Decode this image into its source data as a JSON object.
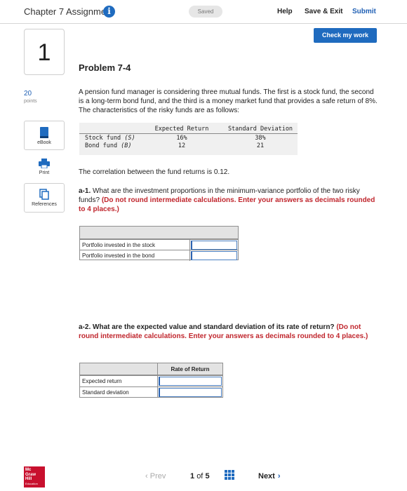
{
  "header": {
    "title": "Chapter 7 Assignment",
    "info_glyph": "i",
    "saved": "Saved",
    "help": "Help",
    "save_exit": "Save & Exit",
    "submit": "Submit",
    "check_work": "Check my work"
  },
  "question": {
    "number": "1",
    "points": "20",
    "points_label": "points"
  },
  "tools": {
    "ebook": "eBook",
    "print": "Print",
    "references": "References"
  },
  "problem": {
    "title": "Problem 7-4",
    "intro": "A pension fund manager is considering three mutual funds. The first is a stock fund, the second is a long-term bond fund, and the third is a money market fund that provides a safe return of 8%. The characteristics of the risky funds are as follows:",
    "table": {
      "headers": [
        "Expected Return",
        "Standard Deviation"
      ],
      "rows": [
        {
          "name": "Stock fund",
          "symbol": "(S)",
          "expected_return": "16%",
          "std_dev": "38%"
        },
        {
          "name": "Bond fund",
          "symbol": "(B)",
          "expected_return": "12",
          "std_dev": "21"
        }
      ]
    },
    "correlation": "The correlation between the fund returns is 0.12.",
    "a1": {
      "label": "a-1.",
      "text": "What are the investment proportions in the minimum-variance portfolio of the two risky funds?",
      "instruction": "(Do not round intermediate calculations. Enter your answers as decimals rounded to 4 places.)",
      "rows": [
        "Portfolio invested in the stock",
        "Portfolio invested in the bond"
      ]
    },
    "a2": {
      "label": "a-2.",
      "text": "What are the expected value and standard deviation of its rate of return?",
      "instruction": "(Do not round intermediate calculations. Enter your answers as decimals rounded to 4 places.)",
      "column": "Rate of Return",
      "rows": [
        "Expected return",
        "Standard deviation"
      ]
    }
  },
  "footer": {
    "logo_lines": [
      "Mc",
      "Graw",
      "Hill",
      "Education"
    ],
    "prev": "Prev",
    "page_current": "1",
    "page_of": "of",
    "page_total": "5",
    "next": "Next"
  },
  "colors": {
    "accent": "#1f6bbf",
    "link": "#1f5fb4",
    "instruction_red": "#c0262d",
    "logo_red": "#c8102e"
  }
}
